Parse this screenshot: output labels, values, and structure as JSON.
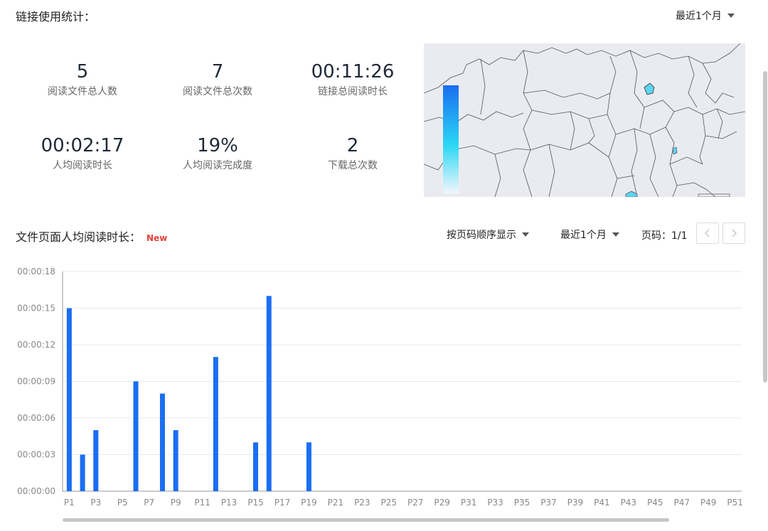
{
  "header": {
    "title": "链接使用统计：",
    "range_label": "最近1个月"
  },
  "stats": [
    {
      "value": "5",
      "label": "阅读文件总人数"
    },
    {
      "value": "7",
      "label": "阅读文件总次数"
    },
    {
      "value": "00:11:26",
      "label": "链接总阅读时长"
    },
    {
      "value": "00:02:17",
      "label": "人均阅读时长"
    },
    {
      "value": "19%",
      "label": "人均阅读完成度"
    },
    {
      "value": "2",
      "label": "下载总次数"
    }
  ],
  "map": {
    "legend_colors": [
      "#1a6ef0",
      "#2ad7f5",
      "#f2f6fb"
    ],
    "highlight_color": "#5fd3f2"
  },
  "section2": {
    "title": "文件页面人均阅读时长：",
    "badge": "New",
    "order_label": "按页码顺序显示",
    "range_label": "最近1个月",
    "pager_label": "页码：1/1",
    "prev_icon": "chevron-left-icon",
    "next_icon": "chevron-right-icon"
  },
  "chart_data": {
    "type": "bar",
    "categories": [
      "P1",
      "P2",
      "P3",
      "P4",
      "P5",
      "P6",
      "P7",
      "P8",
      "P9",
      "P10",
      "P11",
      "P12",
      "P13",
      "P14",
      "P15",
      "P16",
      "P17",
      "P18",
      "P19",
      "P20",
      "P21",
      "P22",
      "P23",
      "P24",
      "P25",
      "P26",
      "P27",
      "P28",
      "P29",
      "P30",
      "P31",
      "P32",
      "P33",
      "P34",
      "P35",
      "P36",
      "P37",
      "P38",
      "P39",
      "P40",
      "P41",
      "P42",
      "P43",
      "P44",
      "P45",
      "P46",
      "P47",
      "P48",
      "P49",
      "P50",
      "P51"
    ],
    "tick_labels": [
      "P1",
      "P3",
      "P5",
      "P7",
      "P9",
      "P11",
      "P13",
      "P15",
      "P17",
      "P19",
      "P21",
      "P23",
      "P25",
      "P27",
      "P29",
      "P31",
      "P33",
      "P35",
      "P37",
      "P39",
      "P41",
      "P43",
      "P45",
      "P47",
      "P49",
      "P51"
    ],
    "values_seconds": [
      15,
      3,
      5,
      0,
      0,
      9,
      0,
      8,
      5,
      0,
      0,
      11,
      0,
      0,
      4,
      16,
      0,
      0,
      4,
      0,
      0,
      0,
      0,
      0,
      0,
      0,
      0,
      0,
      0,
      0,
      0,
      0,
      0,
      0,
      0,
      0,
      0,
      0,
      0,
      0,
      0,
      0,
      0,
      0,
      0,
      0,
      0,
      0,
      0,
      0,
      0
    ],
    "y_ticks": [
      "00:00:00",
      "00:00:03",
      "00:00:06",
      "00:00:09",
      "00:00:12",
      "00:00:15",
      "00:00:18"
    ],
    "ylim": [
      0,
      18
    ],
    "color": "#1a6ef0",
    "grid": true
  }
}
